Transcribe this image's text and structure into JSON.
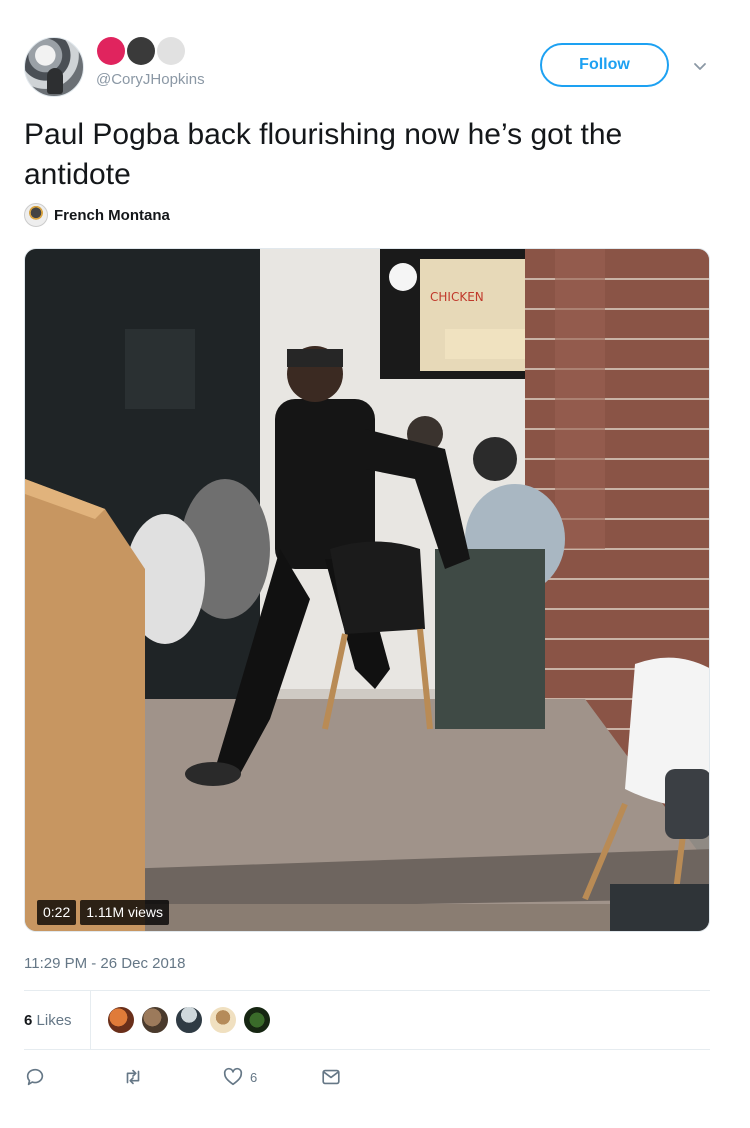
{
  "header": {
    "handle": "@CoryJHopkins",
    "follow_label": "Follow",
    "dot_colors": [
      "#e0245e",
      "#3a3a3a",
      "#e1e1e1"
    ]
  },
  "tweet": {
    "text": "Paul Pogba back flourishing now he’s got the antidote"
  },
  "music": {
    "name": "French Montana"
  },
  "media": {
    "duration": "0:22",
    "views": "1.11M views",
    "screen_text": "CHICKEN"
  },
  "timestamp": "11:29 PM - 26 Dec 2018",
  "likes": {
    "count": "6",
    "label": "Likes"
  },
  "actions": {
    "like_count": "6"
  },
  "colors": {
    "accent": "#1da1f2",
    "muted": "#657786",
    "text": "#14171a"
  }
}
